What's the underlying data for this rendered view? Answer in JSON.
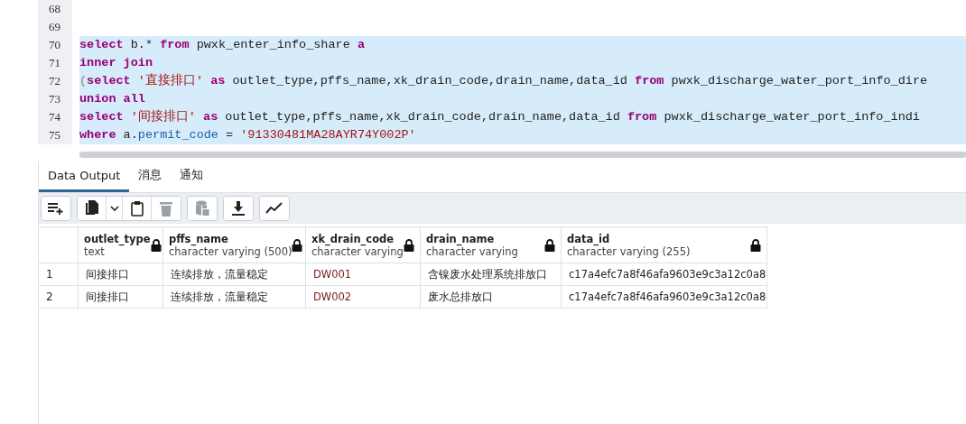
{
  "editor": {
    "lines": [
      {
        "number": "68",
        "selected": false
      },
      {
        "number": "69",
        "selected": false
      },
      {
        "number": "70",
        "selected": true,
        "tokens": [
          {
            "kind": "kw",
            "text": "select"
          },
          {
            "kind": "plain",
            "text": " b.* "
          },
          {
            "kind": "kw",
            "text": "from"
          },
          {
            "kind": "plain",
            "text": " pwxk_enter_info_share "
          },
          {
            "kind": "kw",
            "text": "a"
          }
        ]
      },
      {
        "number": "71",
        "selected": true,
        "tokens": [
          {
            "kind": "kw",
            "text": "inner join"
          }
        ]
      },
      {
        "number": "72",
        "selected": true,
        "tokens": [
          {
            "kind": "punct",
            "text": "("
          },
          {
            "kind": "kw",
            "text": "select "
          },
          {
            "kind": "str",
            "text": "'直接排口' "
          },
          {
            "kind": "kw",
            "text": "as"
          },
          {
            "kind": "plain",
            "text": " outlet_type,pffs_name,xk_drain_code,drain_name,data_id "
          },
          {
            "kind": "kw",
            "text": "from"
          },
          {
            "kind": "plain",
            "text": " pwxk_discharge_water_port_info_dire"
          }
        ]
      },
      {
        "number": "73",
        "selected": true,
        "tokens": [
          {
            "kind": "kw",
            "text": "union all"
          }
        ]
      },
      {
        "number": "74",
        "selected": true,
        "tokens": [
          {
            "kind": "kw",
            "text": "select "
          },
          {
            "kind": "str",
            "text": "'间接排口' "
          },
          {
            "kind": "kw",
            "text": "as"
          },
          {
            "kind": "plain",
            "text": " outlet_type,pffs_name,xk_drain_code,drain_name,data_id "
          },
          {
            "kind": "kw",
            "text": "from"
          },
          {
            "kind": "plain",
            "text": " pwxk_discharge_water_port_info_indi"
          }
        ]
      },
      {
        "number": "75",
        "selected": true,
        "tokens": [
          {
            "kind": "kw",
            "text": "where"
          },
          {
            "kind": "plain",
            "text": " a."
          },
          {
            "kind": "prop",
            "text": "permit_code"
          },
          {
            "kind": "plain",
            "text": " = "
          },
          {
            "kind": "str",
            "text": "'91330481MA28AYR74Y002P'"
          }
        ]
      }
    ]
  },
  "tabs": [
    {
      "label": "Data Output",
      "selected": true
    },
    {
      "label": "消息",
      "selected": false
    },
    {
      "label": "通知",
      "selected": false
    }
  ],
  "toolbar": [
    {
      "kind": "add-row",
      "disabled": false
    },
    {
      "kind": "copy",
      "disabled": false
    },
    {
      "kind": "dropdown",
      "disabled": false
    },
    {
      "kind": "paste",
      "disabled": false
    },
    {
      "kind": "delete",
      "disabled": true
    },
    {
      "kind": "save-data",
      "disabled": true
    },
    {
      "kind": "download",
      "disabled": false
    },
    {
      "kind": "graph",
      "disabled": false
    }
  ],
  "table": {
    "columns": [
      {
        "name": "outlet_type",
        "type": "text",
        "locked": true
      },
      {
        "name": "pffs_name",
        "type": "character varying (500)",
        "locked": true
      },
      {
        "name": "xk_drain_code",
        "type": "character varying",
        "locked": true
      },
      {
        "name": "drain_name",
        "type": "character varying",
        "locked": true
      },
      {
        "name": "data_id",
        "type": "character varying (255)",
        "locked": true
      }
    ],
    "rows": [
      {
        "number": "1",
        "cells": [
          "间接排口",
          "连续排放，流量稳定",
          "DW001",
          "含镍废水处理系统排放口",
          "c17a4efc7a8f46afa9603e9c3a12c0a8"
        ]
      },
      {
        "number": "2",
        "cells": [
          "间接排口",
          "连续排放，流量稳定",
          "DW002",
          "废水总排放口",
          "c17a4efc7a8f46afa9603e9c3a12c0a8"
        ]
      }
    ]
  }
}
